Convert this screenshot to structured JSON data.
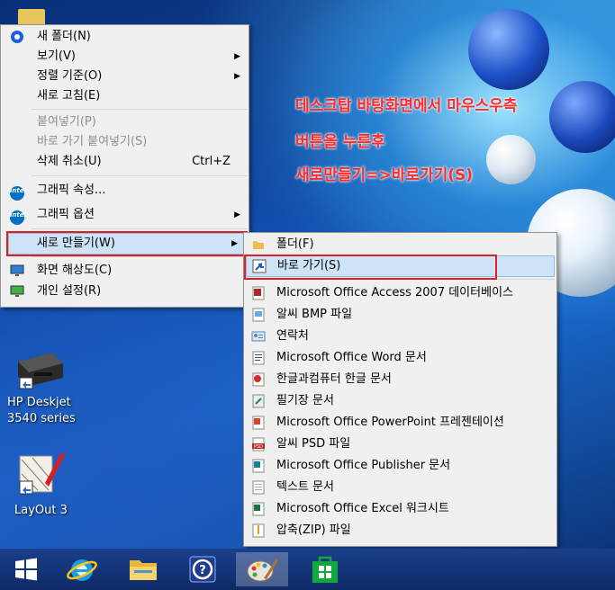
{
  "annotation": {
    "line1": "데스크탑 바탕화면에서 마우스우측",
    "line2": "버튼을 누른후",
    "line3": "새로만들기=>바로가기(S)"
  },
  "context_menu": {
    "items": [
      {
        "label": "새 폴더(N)",
        "icon": "new-folder-icon"
      },
      {
        "label": "보기(V)",
        "submenu": true
      },
      {
        "label": "정렬 기준(O)",
        "submenu": true
      },
      {
        "label": "새로 고침(E)"
      },
      {
        "label": "붙여넣기(P)",
        "disabled": true
      },
      {
        "label": "바로 가기 붙여넣기(S)",
        "disabled": true
      },
      {
        "label": "삭제 취소(U)",
        "shortcut": "Ctrl+Z"
      },
      {
        "label": "그래픽 속성...",
        "icon": "intel-icon"
      },
      {
        "label": "그래픽 옵션",
        "icon": "intel-icon",
        "submenu": true
      },
      {
        "label": "새로 만들기(W)",
        "submenu": true,
        "highlighted": true
      },
      {
        "label": "화면 해상도(C)",
        "icon": "display-icon"
      },
      {
        "label": "개인 설정(R)",
        "icon": "personalize-icon"
      }
    ],
    "intel_text": "intel"
  },
  "new_menu": {
    "items": [
      {
        "label": "폴더(F)",
        "icon": "folder-icon"
      },
      {
        "label": "바로 가기(S)",
        "icon": "shortcut-icon",
        "highlighted": true
      },
      {
        "label": "Microsoft Office Access 2007 데이터베이스",
        "icon": "access-icon"
      },
      {
        "label": "알씨 BMP 파일",
        "icon": "bmp-icon"
      },
      {
        "label": "연락처",
        "icon": "contact-icon"
      },
      {
        "label": "Microsoft Office Word 문서",
        "icon": "word-icon"
      },
      {
        "label": "한글과컴퓨터 한글 문서",
        "icon": "hwp-icon"
      },
      {
        "label": "필기장 문서",
        "icon": "journal-icon"
      },
      {
        "label": "Microsoft Office PowerPoint 프레젠테이션",
        "icon": "powerpoint-icon"
      },
      {
        "label": "알씨 PSD 파일",
        "icon": "psd-icon"
      },
      {
        "label": "Microsoft Office Publisher 문서",
        "icon": "publisher-icon"
      },
      {
        "label": "텍스트 문서",
        "icon": "text-icon"
      },
      {
        "label": "Microsoft Office Excel 워크시트",
        "icon": "excel-icon"
      },
      {
        "label": "압축(ZIP) 파일",
        "icon": "zip-icon"
      }
    ],
    "psd_badge": "PSD"
  },
  "desktop_icons": {
    "printer": {
      "line1": "HP Deskjet",
      "line2": "3540 series"
    },
    "layout": {
      "label": "LayOut 3"
    }
  },
  "taskbar": {
    "buttons": [
      "start-button",
      "internet-explorer",
      "file-explorer",
      "help-app",
      "paint-app",
      "store-app"
    ],
    "active": "paint-app"
  }
}
